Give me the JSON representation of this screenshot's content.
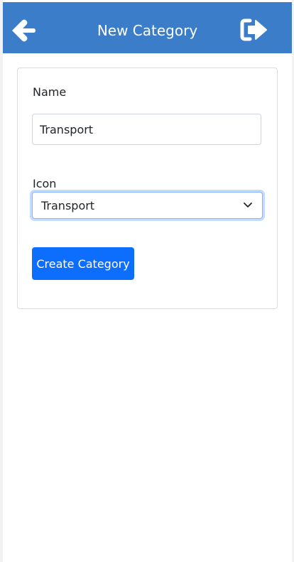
{
  "header": {
    "title": "New Category",
    "back_icon": "arrow-left-icon",
    "logout_icon": "sign-out-icon",
    "bg_color": "#3b7dc8"
  },
  "form": {
    "name_label": "Name",
    "name_value": "Transport",
    "icon_label": "Icon",
    "icon_selected": "Transport",
    "submit_label": "Create Category",
    "submit_color": "#0d6efd"
  }
}
